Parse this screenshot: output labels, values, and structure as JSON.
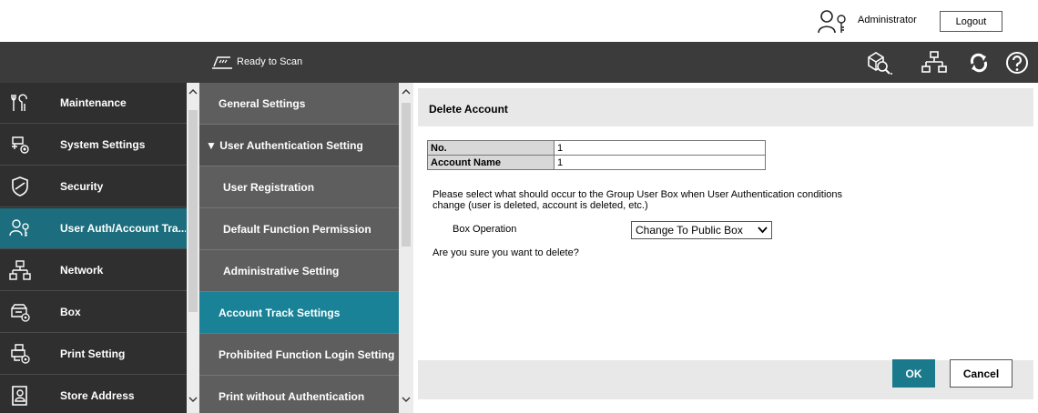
{
  "header": {
    "user_icon": "user-key-icon",
    "user_name": "Administrator",
    "logout_label": "Logout"
  },
  "statusbar": {
    "status_icon": "scanner-icon",
    "status_text": "Ready to Scan",
    "icons": [
      "search-device-icon",
      "network-icon",
      "refresh-icon",
      "help-icon"
    ]
  },
  "left_nav": {
    "items": [
      {
        "label": "Maintenance",
        "icon": "wrench-icon"
      },
      {
        "label": "System Settings",
        "icon": "system-settings-icon"
      },
      {
        "label": "Security",
        "icon": "shield-icon"
      },
      {
        "label": "User Auth/Account Tra...",
        "icon": "user-key-icon",
        "active": true
      },
      {
        "label": "Network",
        "icon": "network-icon"
      },
      {
        "label": "Box",
        "icon": "box-icon"
      },
      {
        "label": "Print Setting",
        "icon": "printer-icon"
      },
      {
        "label": "Store Address",
        "icon": "address-book-icon"
      }
    ]
  },
  "mid_nav": {
    "items": [
      {
        "label": "General Settings"
      },
      {
        "label": "▼ User Authentication Setting"
      },
      {
        "label": "User Registration"
      },
      {
        "label": "Default Function Permission"
      },
      {
        "label": "Administrative Setting"
      },
      {
        "label": "Account Track Settings",
        "active": true
      },
      {
        "label": "Prohibited Function Login Setting"
      },
      {
        "label": "Print without Authentication"
      }
    ]
  },
  "content": {
    "title": "Delete Account",
    "table": [
      {
        "key": "No.",
        "value": "1"
      },
      {
        "key": "Account Name",
        "value": "1"
      }
    ],
    "message": "Please select what should occur to the Group User Box when User Authentication conditions change (user is deleted, account is deleted, etc.)",
    "box_operation_label": "Box Operation",
    "box_operation_value": "Change To Public Box",
    "confirm_text": "Are you sure you want to delete?",
    "ok_label": "OK",
    "cancel_label": "Cancel"
  },
  "colors": {
    "active_teal": "#1c6e7e",
    "active_mid_teal": "#1a8297",
    "ok_button": "#1a7a8c"
  }
}
